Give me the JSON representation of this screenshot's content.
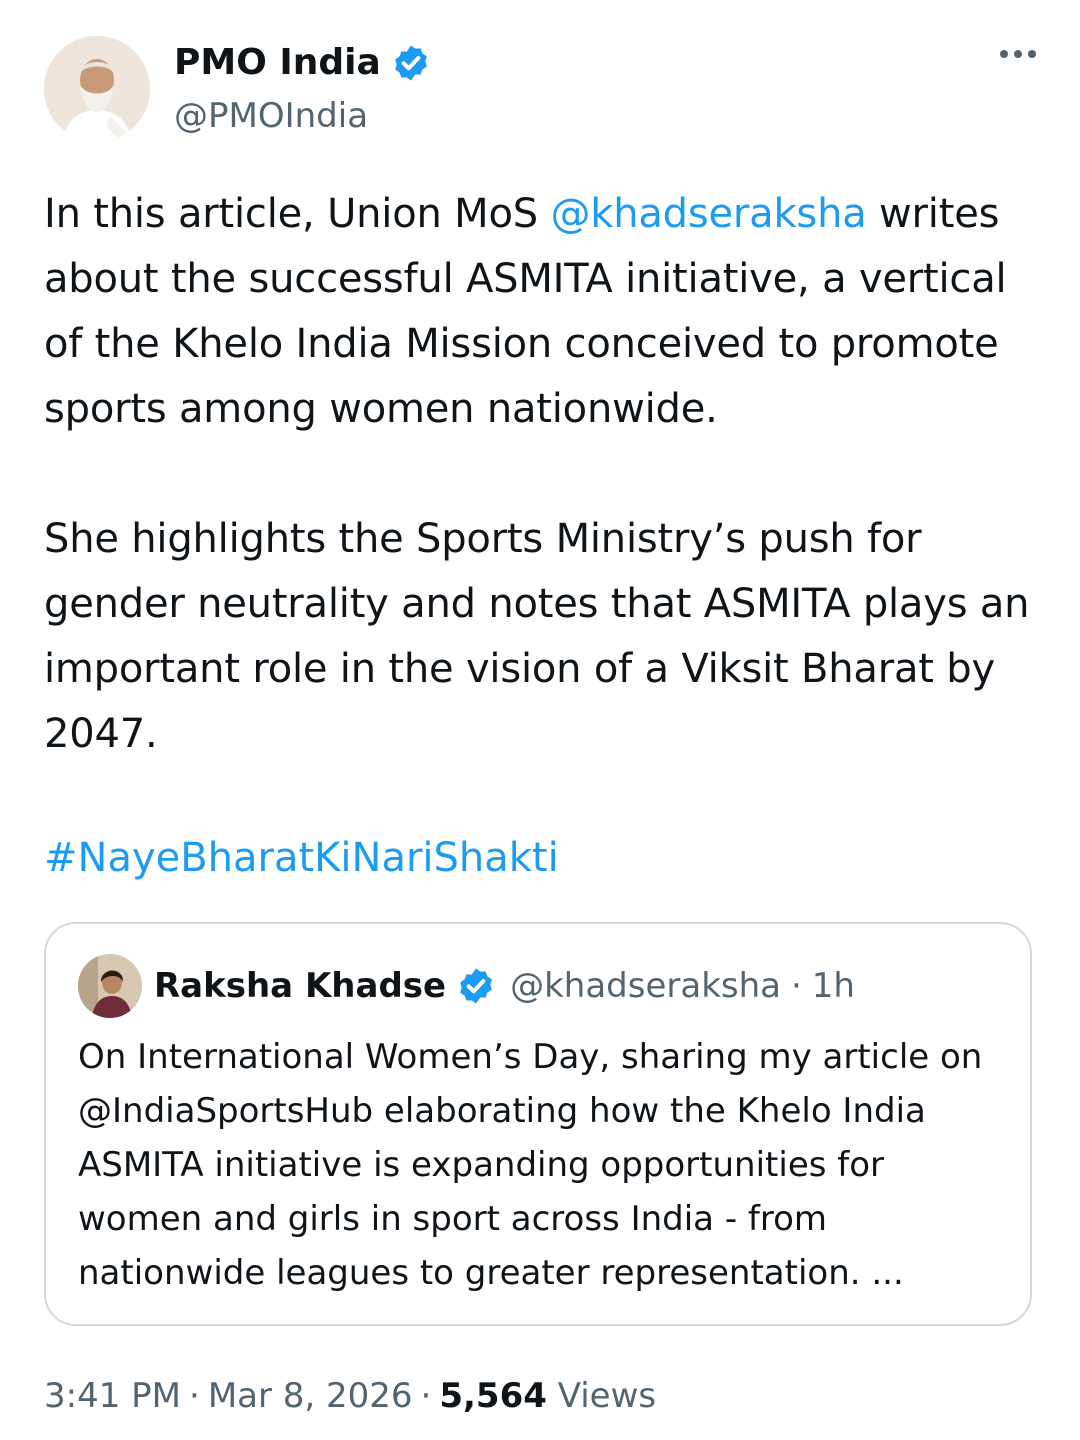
{
  "author": {
    "display_name": "PMO India",
    "handle": "@PMOIndia",
    "verified_color": "#1d9bf0"
  },
  "tweet": {
    "paragraph1": {
      "before": "In this article, Union MoS ",
      "mention": "@khadseraksha",
      "after": " writes about the successful ASMITA initiative, a vertical of the Khelo India Mission conceived to promote sports among women nationwide."
    },
    "paragraph2": "She highlights the Sports Ministry’s push for gender neutrality and notes that ASMITA plays an important role in the vision of a Viksit Bharat by 2047.",
    "hashtag": "#NayeBharatKiNariShakti"
  },
  "quoted": {
    "display_name": "Raksha Khadse",
    "handle": "@khadseraksha",
    "separator": "·",
    "time": "1h",
    "text": "On International Women’s Day, sharing my article on @IndiaSportsHub elaborating how the Khelo India ASMITA initiative is expanding opportunities for women and girls in sport across India - from nationwide leagues to greater representation. ..."
  },
  "meta": {
    "time": "3:41 PM",
    "sep1": "·",
    "date": "Mar 8, 2026",
    "sep2": "·",
    "views_count": "5,564",
    "views_label": "Views"
  },
  "colors": {
    "link": "#1d9bf0",
    "secondary_text": "#536471",
    "border": "#cfd9de"
  }
}
